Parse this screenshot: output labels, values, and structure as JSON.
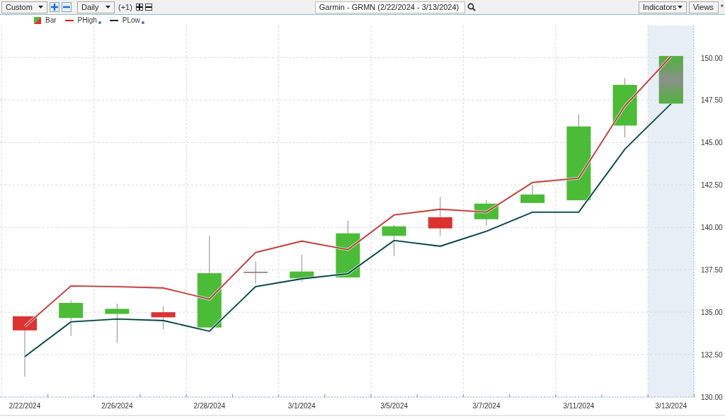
{
  "toolbar": {
    "period": {
      "value": "Custom"
    },
    "interval": {
      "value": "Daily"
    },
    "offset": "(+1)",
    "title": {
      "value": "Garmin - GRMN (2/22/2024 - 3/13/2024)"
    },
    "indicators": {
      "value": "Indicators"
    },
    "views": {
      "value": "Views"
    },
    "modified_mark": "*"
  },
  "chart": {
    "chart_data": {
      "type": "candlestick",
      "ylim": [
        130,
        151.9
      ],
      "grid": true,
      "bands": [
        {
          "axis": "x",
          "from": "3/13/2024",
          "to": "3/13/2024",
          "color": "#e8eef6"
        }
      ],
      "categories": [
        "2/22/2024",
        null,
        "2/26/2024",
        null,
        "2/28/2024",
        null,
        "3/1/2024",
        null,
        "3/5/2024",
        null,
        "3/7/2024",
        null,
        "3/11/2024",
        null,
        "3/13/2024"
      ],
      "yticks": [
        {
          "value": 130,
          "label": "130.00"
        },
        {
          "value": 132.5,
          "label": "132.50"
        },
        {
          "value": 135,
          "label": "135.00"
        },
        {
          "value": 137.5,
          "label": "137.50"
        },
        {
          "value": 140,
          "label": "140.00"
        },
        {
          "value": 142.5,
          "label": "142.50"
        },
        {
          "value": 145,
          "label": "145.00"
        },
        {
          "value": 147.5,
          "label": "147.50"
        },
        {
          "value": 150,
          "label": "150.00"
        }
      ],
      "series": [
        {
          "name": "Bar",
          "ohlc": [
            [
              134.76,
              134.76,
              131.2,
              133.93
            ],
            [
              134.66,
              135.7,
              133.6,
              135.55
            ],
            [
              134.9,
              135.5,
              133.2,
              135.2
            ],
            [
              135.0,
              135.35,
              134.0,
              134.7
            ],
            [
              134.1,
              139.5,
              134.1,
              137.3
            ],
            [
              137.35,
              138.0,
              136.7,
              137.35
            ],
            [
              137.0,
              138.4,
              136.8,
              137.4
            ],
            [
              137.05,
              140.4,
              137.05,
              139.65
            ],
            [
              139.5,
              140.15,
              138.3,
              140.06
            ],
            [
              140.6,
              141.8,
              139.5,
              139.94
            ],
            [
              140.48,
              141.6,
              140.1,
              141.4
            ],
            [
              141.44,
              142.5,
              141.44,
              141.94
            ],
            [
              141.6,
              146.66,
              141.6,
              145.95
            ],
            [
              146.0,
              148.8,
              145.3,
              148.4
            ],
            [
              147.3,
              150.1,
              147.3,
              150.1
            ]
          ]
        },
        {
          "name": "PHigh",
          "type": "line",
          "color": "#e0201c",
          "values": [
            134.17,
            136.55,
            136.51,
            136.43,
            135.77,
            138.52,
            139.19,
            138.69,
            140.73,
            141.07,
            140.9,
            142.65,
            142.9,
            147.16,
            150.08
          ]
        },
        {
          "name": "PLow",
          "type": "line",
          "color": "#0a2a2a",
          "values": [
            132.38,
            134.43,
            134.6,
            134.51,
            133.88,
            136.51,
            136.97,
            137.27,
            139.23,
            138.89,
            139.77,
            140.9,
            140.9,
            144.61,
            147.29
          ]
        }
      ]
    }
  }
}
